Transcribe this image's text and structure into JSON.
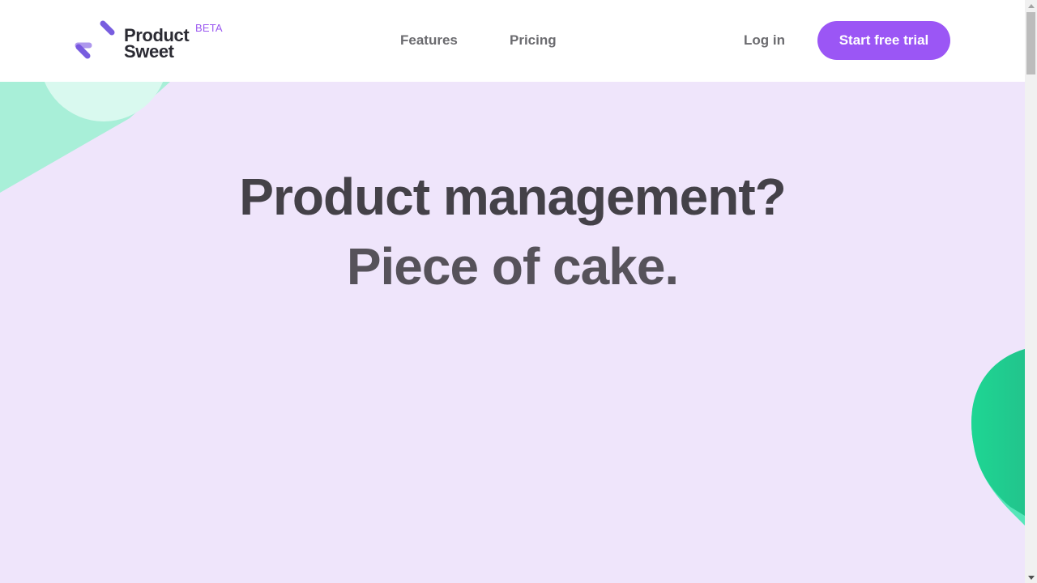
{
  "brand": {
    "name_line1": "Product",
    "name_line2": "Sweet",
    "badge": "BETA",
    "logo_icon": "productsweet-logo-icon"
  },
  "nav": {
    "items": [
      {
        "label": "Features"
      },
      {
        "label": "Pricing"
      }
    ],
    "login_label": "Log in",
    "cta_label": "Start free trial"
  },
  "hero": {
    "headline_line1": "Product management?",
    "headline_line2": "Piece of cake."
  },
  "colors": {
    "accent": "#9b56f5",
    "hero_background": "#efe5fb",
    "mint": "#a8efd8",
    "green": "#1ed391",
    "text_dark": "#444148",
    "nav_text": "#6b6b6f"
  }
}
